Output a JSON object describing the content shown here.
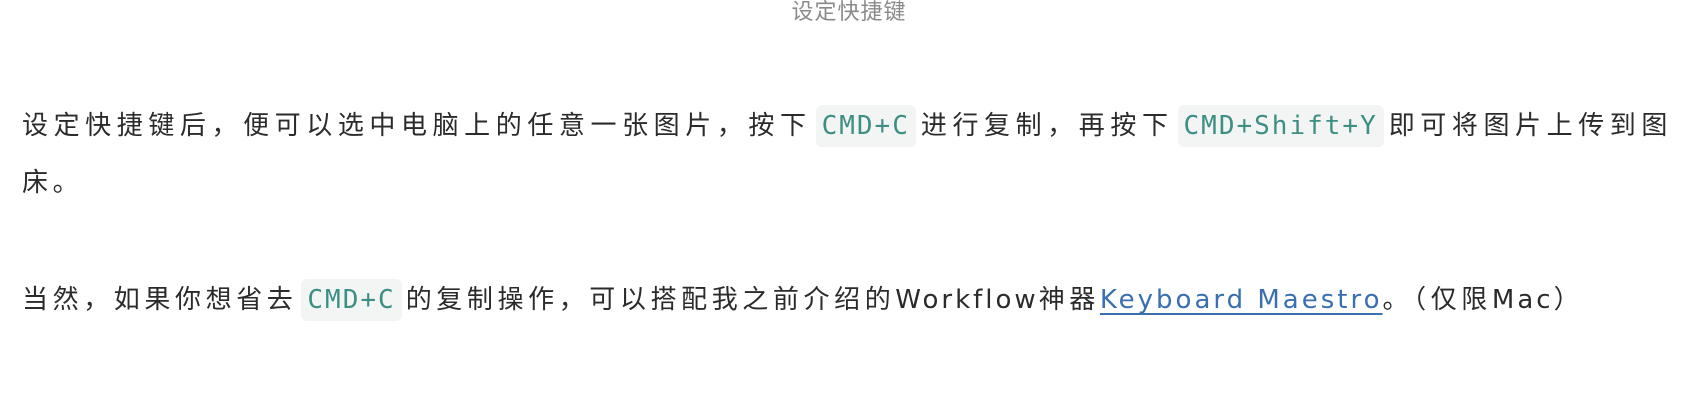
{
  "caption": "设定快捷键",
  "paragraph1": {
    "text1": "设定快捷键后，便可以选中电脑上的任意一张图片，按下",
    "code1": "CMD+C",
    "text2": "进行复制，再按下",
    "code2": "CMD+Shift+Y",
    "text3": "即可将图片上传到图床。"
  },
  "paragraph2": {
    "text1": "当然，如果你想省去",
    "code1": "CMD+C",
    "text2": "的复制操作，可以搭配我之前介绍的",
    "latin1": "Workflow",
    "text3": "神器",
    "link": "Keyboard Maestro",
    "text4": "。（仅限",
    "latin2": "Mac",
    "text5": "）"
  },
  "colors": {
    "code_text": "#3d8f84",
    "code_bg": "#f3f5f4",
    "link": "#3a6fb0",
    "caption": "#8a8a8a",
    "body_text": "#2b2b2b"
  }
}
